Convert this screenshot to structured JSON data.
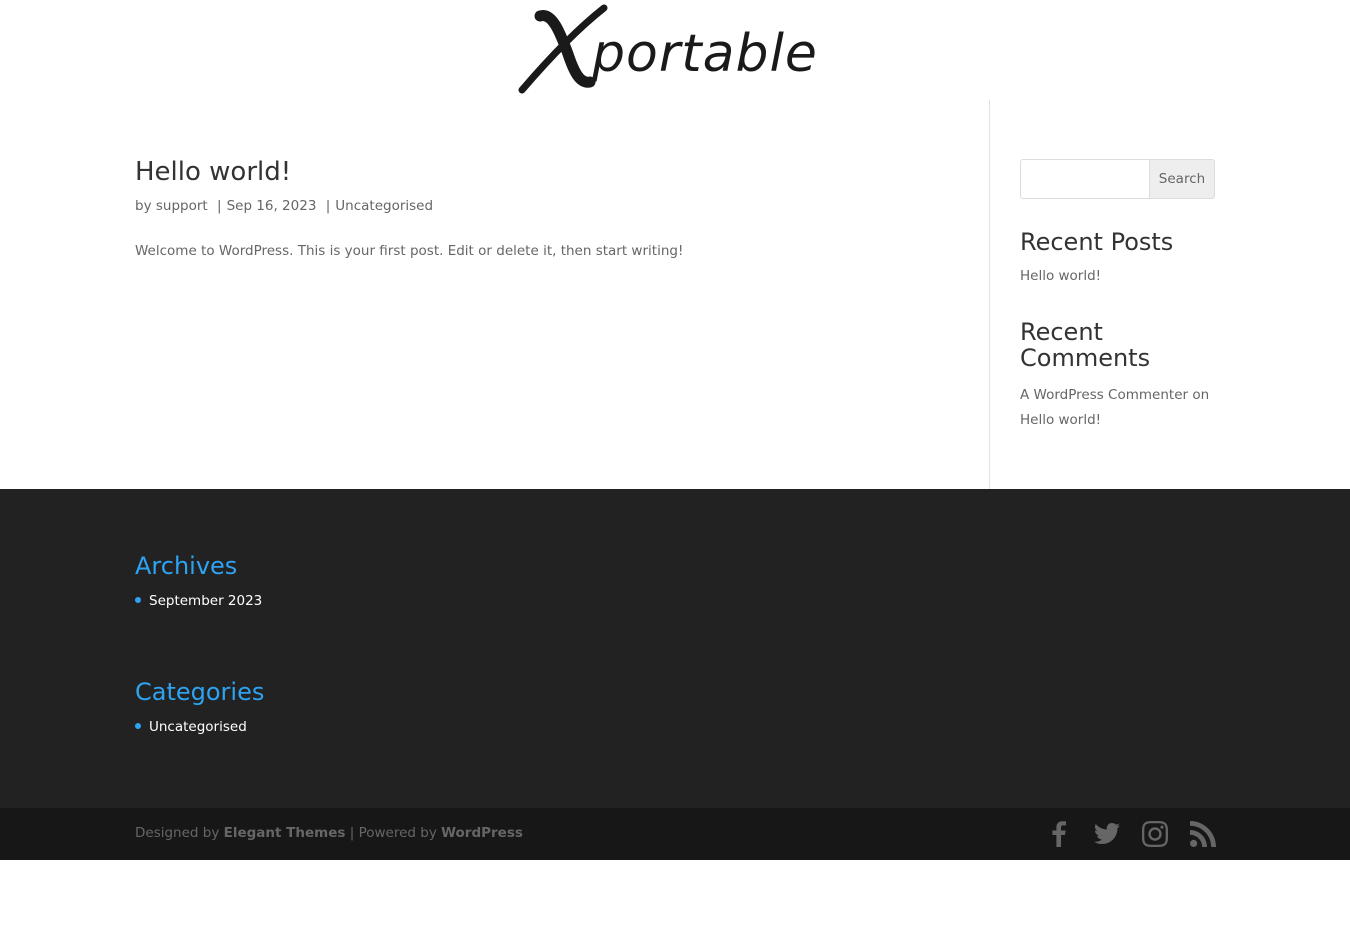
{
  "header": {
    "logo_text": "portable",
    "logo_initial": "X"
  },
  "post": {
    "title": "Hello world!",
    "meta_by": "by",
    "author": "support",
    "date": "Sep 16, 2023",
    "category": "Uncategorised",
    "separator": "|",
    "excerpt": "Welcome to WordPress. This is your first post. Edit or delete it, then start writing!"
  },
  "sidebar": {
    "search_placeholder": "",
    "search_button": "Search",
    "recent_posts_title": "Recent Posts",
    "recent_posts": [
      "Hello world!"
    ],
    "recent_comments_title": "Recent Comments",
    "comment_author": "A WordPress Commenter",
    "comment_on": "on",
    "comment_post": "Hello world!"
  },
  "footer": {
    "archives_title": "Archives",
    "archives": [
      "September 2023"
    ],
    "categories_title": "Categories",
    "categories": [
      "Uncategorised"
    ],
    "credits_designed": "Designed by",
    "credits_elegant": "Elegant Themes",
    "credits_sep": "|",
    "credits_powered": "Powered by",
    "credits_wordpress": "WordPress",
    "social_icons": [
      "facebook-icon",
      "twitter-icon",
      "instagram-icon",
      "rss-icon"
    ]
  },
  "colors": {
    "accent": "#2ea3f2",
    "footer_bg": "#222222",
    "bottom_bar_bg": "#171717"
  }
}
